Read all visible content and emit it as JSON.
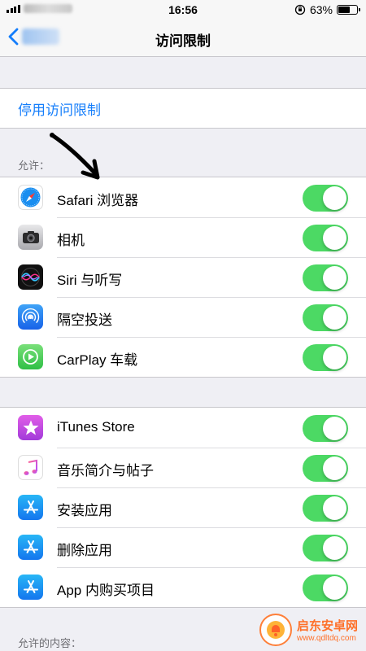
{
  "status_bar": {
    "time": "16:56",
    "battery": "63%",
    "battery_level": 0.63
  },
  "nav": {
    "title": "访问限制"
  },
  "disable_link": "停用访问限制",
  "allow_section": {
    "label": "允许：",
    "items": [
      {
        "label": "Safari 浏览器",
        "icon": "safari-icon",
        "on": true
      },
      {
        "label": "相机",
        "icon": "camera-icon",
        "on": true
      },
      {
        "label": "Siri 与听写",
        "icon": "siri-icon",
        "on": true
      },
      {
        "label": "隔空投送",
        "icon": "airdrop-icon",
        "on": true
      },
      {
        "label": "CarPlay 车载",
        "icon": "carplay-icon",
        "on": true
      }
    ]
  },
  "store_section": {
    "items": [
      {
        "label": "iTunes Store",
        "icon": "itunes-store-icon",
        "on": true
      },
      {
        "label": "音乐简介与帖子",
        "icon": "music-icon",
        "on": true
      },
      {
        "label": "安装应用",
        "icon": "app-store-icon",
        "on": true
      },
      {
        "label": "删除应用",
        "icon": "app-store-icon",
        "on": true
      },
      {
        "label": "App 内购买项目",
        "icon": "app-store-icon",
        "on": true
      }
    ]
  },
  "content_section": {
    "label": "允许的内容："
  },
  "watermark": {
    "name": "启东安卓网",
    "url": "www.qdltdq.com"
  },
  "colors": {
    "tint": "#157efb",
    "switch_on": "#4cd964",
    "background": "#efeff4"
  }
}
